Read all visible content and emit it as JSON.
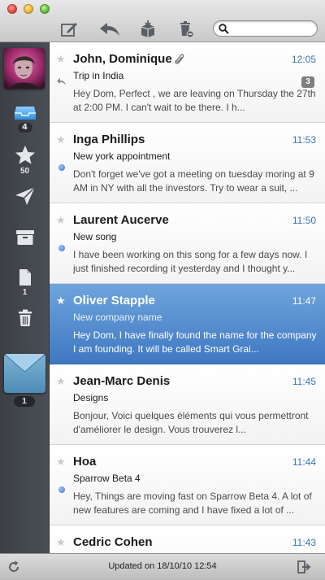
{
  "toolbar": {
    "compose_icon": "compose-icon",
    "reply_icon": "reply-icon",
    "archive_icon": "archive-box-icon",
    "delete_icon": "trash-icon",
    "search_placeholder": ""
  },
  "sidebar": {
    "inbox_count": "4",
    "starred_count": "50",
    "drafts_count": "1",
    "envelope_count": "1"
  },
  "messages": [
    {
      "sender": "John, Dominique",
      "time": "12:05",
      "subject": "Trip in India",
      "preview": "Hey Dom, Perfect , we are leaving on Thursday the 27th at 2:00 PM. I can't wait to be there. I h...",
      "thread_count": "3"
    },
    {
      "sender": "Inga Phillips",
      "time": "11:53",
      "subject": "New york appointment",
      "preview": "Don't forget we've got a meeting on tuesday moring at 9 AM in NY with all the investors. Try to wear a suit, ..."
    },
    {
      "sender": "Laurent Aucerve",
      "time": "11:50",
      "subject": "New song",
      "preview": "I have been working on this song for a few days now. I just finished recording it yesterday and I thought y..."
    },
    {
      "sender": "Oliver Stapple",
      "time": "11:47",
      "subject": "New company name",
      "preview": "Hey Dom, I have finally found the name for the company I am founding. It will be called Smart Grai..."
    },
    {
      "sender": "Jean-Marc Denis",
      "time": "11:45",
      "subject": "Designs",
      "preview": "Bonjour, Voici quelques éléments qui vous permettront d'améliorer le design. Vous trouverez l..."
    },
    {
      "sender": "Hoa",
      "time": "11:44",
      "subject": "Sparrow Beta 4",
      "preview": "Hey, Things are moving fast on Sparrow Beta 4. A lot of new features are coming and I have fixed a lot of ..."
    },
    {
      "sender": "Cedric Cohen",
      "time": "11:43",
      "subject": "",
      "preview": ""
    }
  ],
  "status": {
    "updated": "Updated on 18/10/10 12:54"
  },
  "colors": {
    "accent": "#3a75b6",
    "selection": "#4f86cb",
    "sidebar": "#43474d"
  }
}
